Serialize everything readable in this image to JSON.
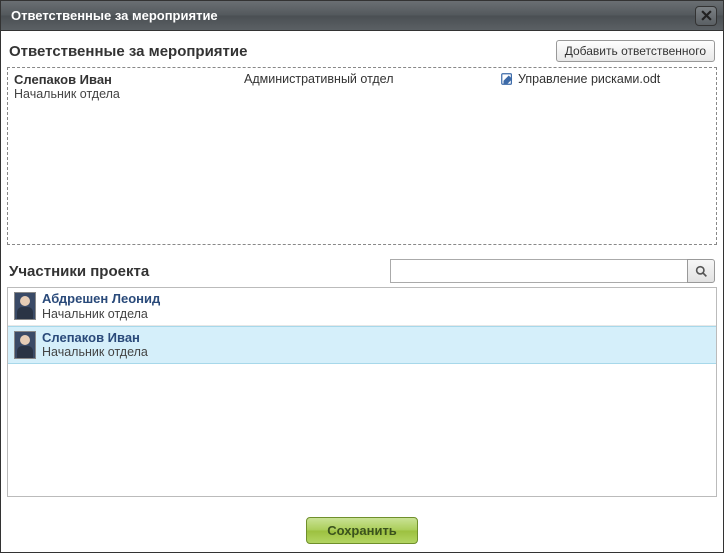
{
  "dialog": {
    "title": "Ответственные за мероприятие"
  },
  "responsibles": {
    "title": "Ответственные за мероприятие",
    "add_label": "Добавить ответственного",
    "rows": [
      {
        "name": "Слепаков Иван",
        "role": "Начальник отдела",
        "department": "Административный отдел",
        "document": "Управление рисками.odt"
      }
    ]
  },
  "members": {
    "title": "Участники проекта",
    "search_placeholder": "",
    "rows": [
      {
        "name": "Абдрешен Леонид",
        "role": "Начальник отдела",
        "selected": false
      },
      {
        "name": "Слепаков Иван",
        "role": "Начальник отдела",
        "selected": true
      }
    ]
  },
  "footer": {
    "save_label": "Сохранить"
  }
}
